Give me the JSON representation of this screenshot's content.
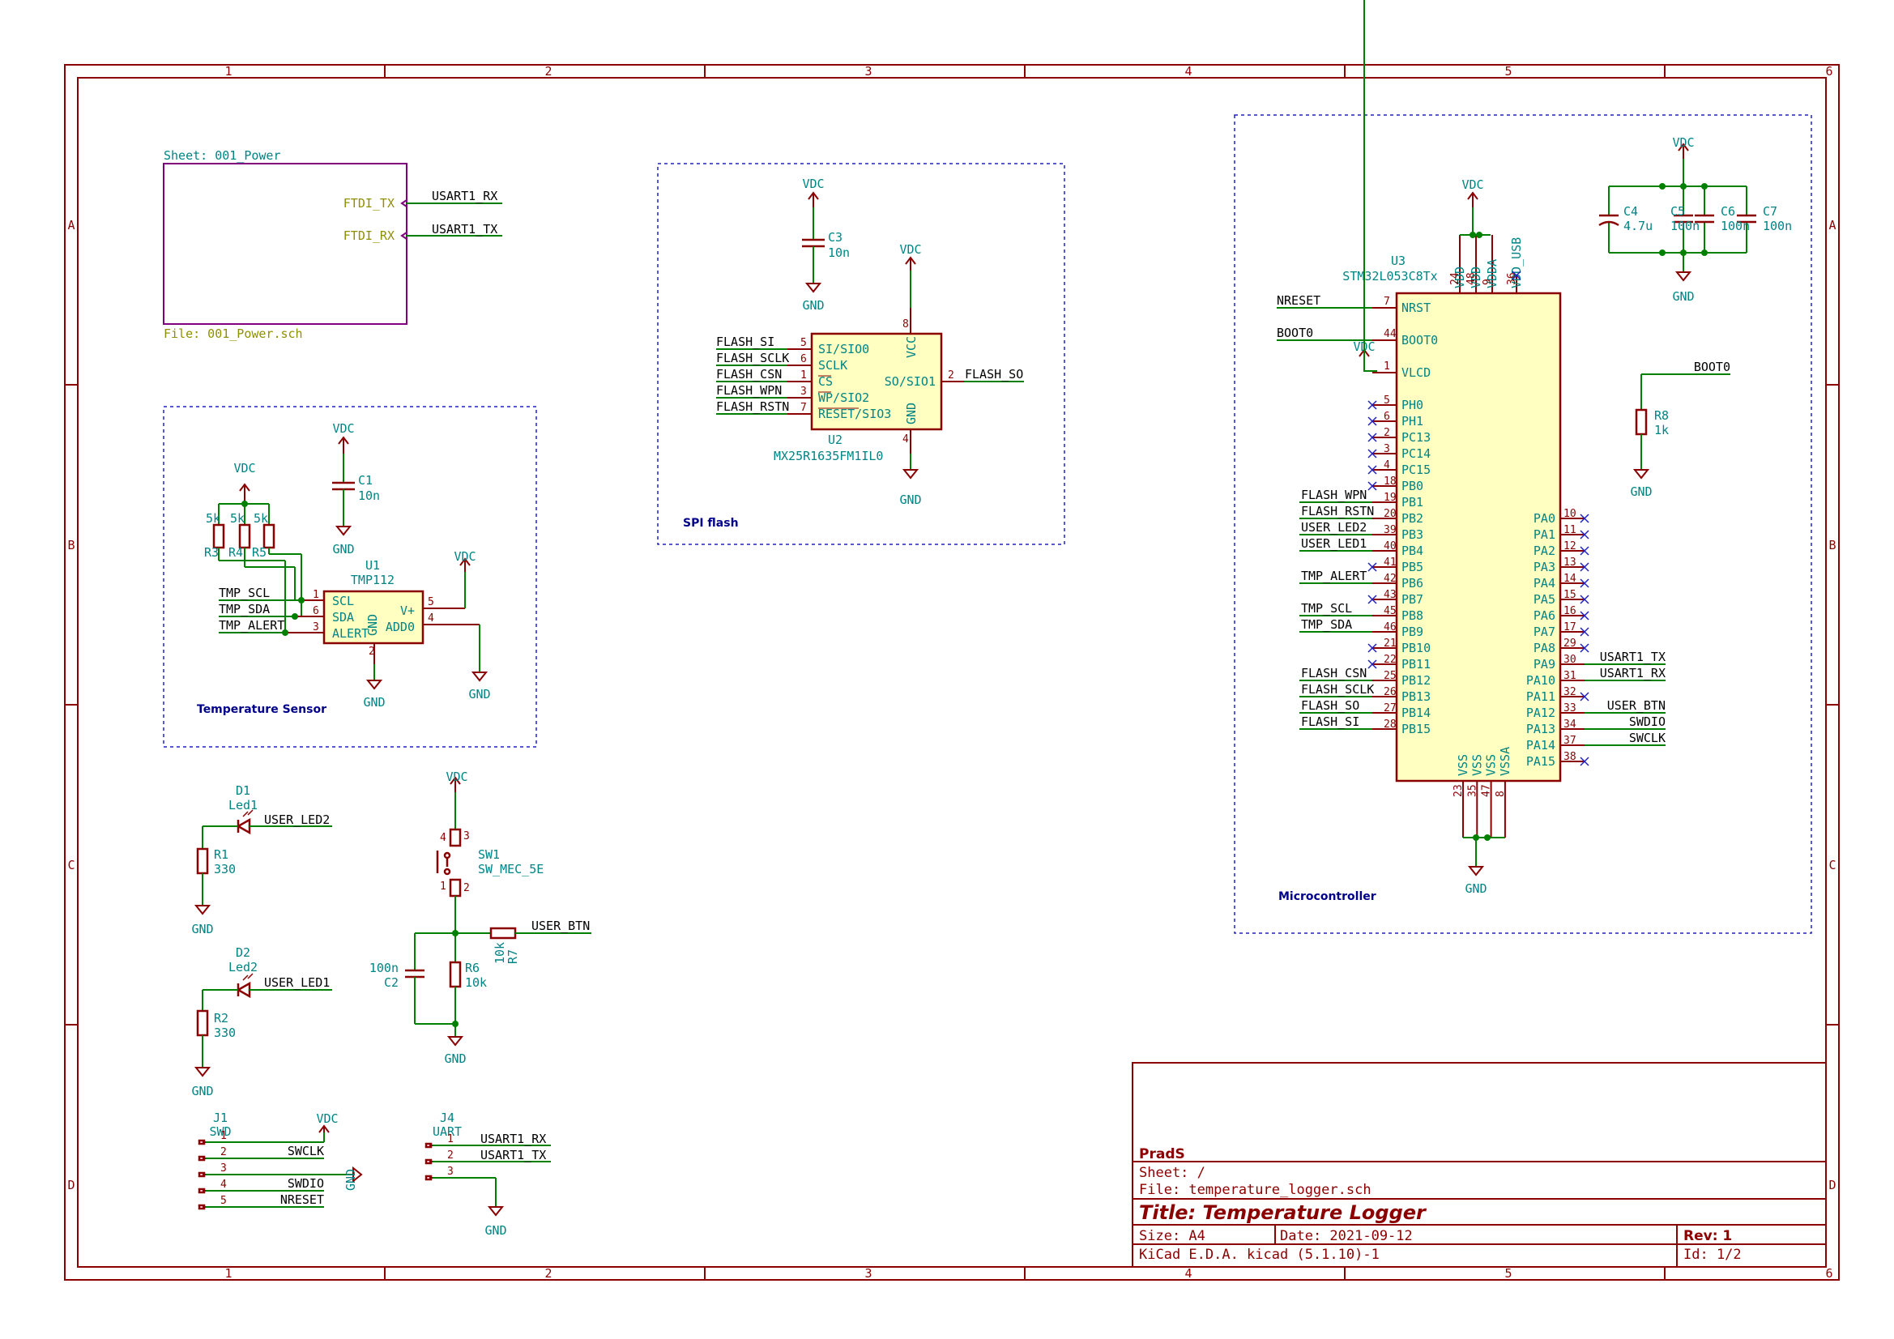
{
  "grid": {
    "cols": [
      "1",
      "2",
      "3",
      "4",
      "5",
      "6"
    ],
    "rows": [
      "A",
      "B",
      "C",
      "D"
    ]
  },
  "sheet_symbol": {
    "name": "Sheet: 001_Power",
    "file": "File: 001_Power.sch",
    "pins": [
      "FTDI_TX",
      "FTDI_RX"
    ],
    "labels": [
      "USART1_RX",
      "USART1_TX"
    ]
  },
  "notes": {
    "temp": "Temperature Sensor",
    "spi": "SPI flash",
    "mcu": "Microcontroller"
  },
  "power": {
    "vdc": "VDC",
    "gnd": "GND"
  },
  "u1": {
    "ref": "U1",
    "value": "TMP112",
    "pins": {
      "scl": "SCL",
      "sda": "SDA",
      "alert": "ALERT",
      "gnd": "GND",
      "vplus": "V+",
      "add0": "ADD0"
    },
    "nums": [
      "1",
      "6",
      "3",
      "2",
      "5",
      "4"
    ],
    "nets": [
      "TMP_SCL",
      "TMP_SDA",
      "TMP_ALERT"
    ]
  },
  "pullups": {
    "refs": [
      "R3",
      "R4",
      "R5"
    ],
    "value": "5k"
  },
  "c1": {
    "ref": "C1",
    "value": "10n"
  },
  "u2": {
    "ref": "U2",
    "value": "MX25R1635FM1IL0",
    "pins": [
      "SI/SIO0",
      "SCLK",
      "CS",
      "WP/SIO2",
      "RESET/SIO3",
      "VCC",
      "SO/SIO1",
      "GND"
    ],
    "nums": [
      "5",
      "6",
      "1",
      "3",
      "7",
      "8",
      "2",
      "4"
    ],
    "nets": [
      "FLASH_SI",
      "FLASH_SCLK",
      "FLASH_CSN",
      "FLASH_WPN",
      "FLASH_RSTN",
      "FLASH_SO"
    ]
  },
  "c3": {
    "ref": "C3",
    "value": "10n"
  },
  "u3": {
    "ref": "U3",
    "value": "STM32L053C8Tx",
    "top_pins": [
      {
        "name": "VDD",
        "num": "24"
      },
      {
        "name": "VDD",
        "num": "48"
      },
      {
        "name": "VDDA",
        "num": "9"
      },
      {
        "name": "VDD_USB",
        "num": "36"
      }
    ],
    "left_top": [
      {
        "name": "NRST",
        "num": "7",
        "net": "NRESET"
      },
      {
        "name": "BOOT0",
        "num": "44",
        "net": "BOOT0"
      },
      {
        "name": "VLCD",
        "num": "1",
        "net": "VDC"
      }
    ],
    "left_pins": [
      {
        "name": "PH0",
        "num": "5"
      },
      {
        "name": "PH1",
        "num": "6"
      },
      {
        "name": "PC13",
        "num": "2"
      },
      {
        "name": "PC14",
        "num": "3"
      },
      {
        "name": "PC15",
        "num": "4"
      },
      {
        "name": "PB0",
        "num": "18"
      },
      {
        "name": "PB1",
        "num": "19",
        "net": "FLASH_WPN"
      },
      {
        "name": "PB2",
        "num": "20",
        "net": "FLASH_RSTN"
      },
      {
        "name": "PB3",
        "num": "39",
        "net": "USER_LED2"
      },
      {
        "name": "PB4",
        "num": "40",
        "net": "USER_LED1"
      },
      {
        "name": "PB5",
        "num": "41"
      },
      {
        "name": "PB6",
        "num": "42",
        "net": "TMP_ALERT"
      },
      {
        "name": "PB7",
        "num": "43"
      },
      {
        "name": "PB8",
        "num": "45",
        "net": "TMP_SCL"
      },
      {
        "name": "PB9",
        "num": "46",
        "net": "TMP_SDA"
      },
      {
        "name": "PB10",
        "num": "21"
      },
      {
        "name": "PB11",
        "num": "22"
      },
      {
        "name": "PB12",
        "num": "25",
        "net": "FLASH_CSN"
      },
      {
        "name": "PB13",
        "num": "26",
        "net": "FLASH_SCLK"
      },
      {
        "name": "PB14",
        "num": "27",
        "net": "FLASH_SO"
      },
      {
        "name": "PB15",
        "num": "28",
        "net": "FLASH_SI"
      }
    ],
    "right_pins": [
      {
        "name": "PA0",
        "num": "10"
      },
      {
        "name": "PA1",
        "num": "11"
      },
      {
        "name": "PA2",
        "num": "12"
      },
      {
        "name": "PA3",
        "num": "13"
      },
      {
        "name": "PA4",
        "num": "14"
      },
      {
        "name": "PA5",
        "num": "15"
      },
      {
        "name": "PA6",
        "num": "16"
      },
      {
        "name": "PA7",
        "num": "17"
      },
      {
        "name": "PA8",
        "num": "29"
      },
      {
        "name": "PA9",
        "num": "30",
        "net": "USART1_TX"
      },
      {
        "name": "PA10",
        "num": "31",
        "net": "USART1_RX"
      },
      {
        "name": "PA11",
        "num": "32"
      },
      {
        "name": "PA12",
        "num": "33",
        "net": "USER_BTN"
      },
      {
        "name": "PA13",
        "num": "34",
        "net": "SWDIO"
      },
      {
        "name": "PA14",
        "num": "37",
        "net": "SWCLK"
      },
      {
        "name": "PA15",
        "num": "38"
      }
    ],
    "bottom_pins": [
      {
        "name": "VSS",
        "num": "23"
      },
      {
        "name": "VSS",
        "num": "35"
      },
      {
        "name": "VSS",
        "num": "47"
      },
      {
        "name": "VSSA",
        "num": "8"
      }
    ]
  },
  "caps": [
    {
      "ref": "C4",
      "value": "4.7u"
    },
    {
      "ref": "C5",
      "value": "100n"
    },
    {
      "ref": "C6",
      "value": "100n"
    },
    {
      "ref": "C7",
      "value": "100n"
    }
  ],
  "r8": {
    "ref": "R8",
    "value": "1k",
    "net": "BOOT0"
  },
  "d1": {
    "ref": "D1",
    "value": "Led1",
    "net": "USER_LED2"
  },
  "r1": {
    "ref": "R1",
    "value": "330"
  },
  "d2": {
    "ref": "D2",
    "value": "Led2",
    "net": "USER_LED1"
  },
  "r2": {
    "ref": "R2",
    "value": "330"
  },
  "sw1": {
    "ref": "SW1",
    "value": "SW_MEC_5E",
    "nums": [
      "4",
      "3",
      "1",
      "2"
    ]
  },
  "r7": {
    "ref": "R7",
    "value": "10k",
    "net": "USER_BTN"
  },
  "r6": {
    "ref": "R6",
    "value": "10k"
  },
  "c2": {
    "ref": "C2",
    "value": "100n"
  },
  "j1": {
    "ref": "J1",
    "value": "SWD",
    "nums": [
      "1",
      "2",
      "3",
      "4",
      "5"
    ],
    "nets": [
      "SWCLK",
      "SWDIO",
      "NRESET"
    ]
  },
  "j4": {
    "ref": "J4",
    "value": "UART",
    "nums": [
      "1",
      "2",
      "3"
    ],
    "nets": [
      "USART1_RX",
      "USART1_TX"
    ]
  },
  "title_block": {
    "company": "PradS",
    "sheet": "Sheet: /",
    "file": "File: temperature_logger.sch",
    "title": "Title: Temperature Logger",
    "size": "Size: A4",
    "date": "Date: 2021-09-12",
    "rev": "Rev: 1",
    "tool": "KiCad E.D.A.  kicad (5.1.10)-1",
    "id": "Id: 1/2"
  }
}
